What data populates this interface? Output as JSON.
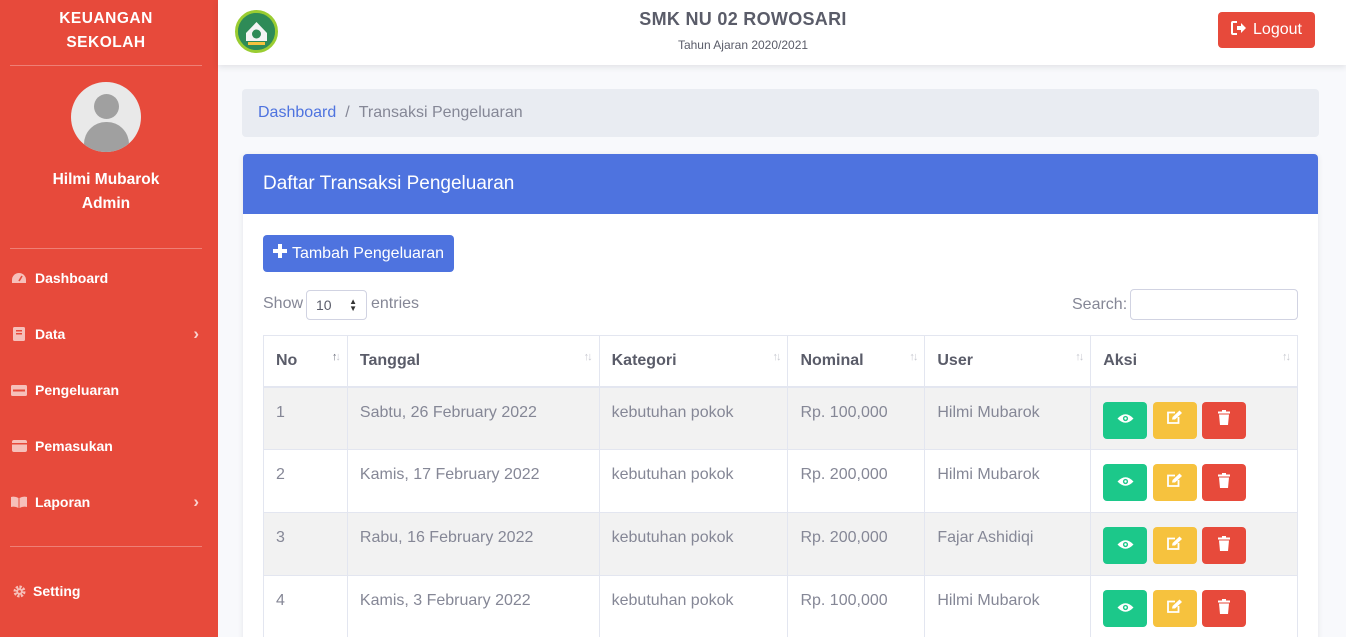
{
  "sidebar": {
    "brand_line1": "KEUANGAN",
    "brand_line2": "SEKOLAH",
    "user_name": "Hilmi Mubarok",
    "user_role": "Admin",
    "items": [
      {
        "label": "Dashboard",
        "icon": "tachometer-icon"
      },
      {
        "label": "Data",
        "icon": "book-icon",
        "chevron": true
      },
      {
        "label": "Pengeluaran",
        "icon": "money-icon"
      },
      {
        "label": "Pemasukan",
        "icon": "wallet-icon"
      },
      {
        "label": "Laporan",
        "icon": "open-book-icon",
        "chevron": true
      },
      {
        "label": "Setting",
        "icon": "gear-icon"
      }
    ]
  },
  "topbar": {
    "school_name": "SMK NU 02 ROWOSARI",
    "school_year": "Tahun Ajaran 2020/2021",
    "logout_label": "Logout"
  },
  "breadcrumb": {
    "home": "Dashboard",
    "separator": "/",
    "current": "Transaksi Pengeluaran"
  },
  "card": {
    "title": "Daftar Transaksi Pengeluaran",
    "add_button_label": "Tambah Pengeluaran",
    "show_label": "Show",
    "entries_value": "10",
    "entries_label": "entries",
    "search_label": "Search:"
  },
  "table": {
    "columns": [
      "No",
      "Tanggal",
      "Kategori",
      "Nominal",
      "User",
      "Aksi"
    ],
    "rows": [
      {
        "no": "1",
        "tanggal": "Sabtu, 26 February 2022",
        "kategori": "kebutuhan pokok",
        "nominal": "Rp. 100,000",
        "user": "Hilmi Mubarok"
      },
      {
        "no": "2",
        "tanggal": "Kamis, 17 February 2022",
        "kategori": "kebutuhan pokok",
        "nominal": "Rp. 200,000",
        "user": "Hilmi Mubarok"
      },
      {
        "no": "3",
        "tanggal": "Rabu, 16 February 2022",
        "kategori": "kebutuhan pokok",
        "nominal": "Rp. 200,000",
        "user": "Fajar Ashidiqi"
      },
      {
        "no": "4",
        "tanggal": "Kamis, 3 February 2022",
        "kategori": "kebutuhan pokok",
        "nominal": "Rp. 100,000",
        "user": "Hilmi Mubarok"
      }
    ]
  },
  "colors": {
    "sidebar": "#e74a3b",
    "primary": "#4e73df",
    "success": "#1cc88a",
    "warning": "#f6c23e",
    "danger": "#e74a3b"
  }
}
